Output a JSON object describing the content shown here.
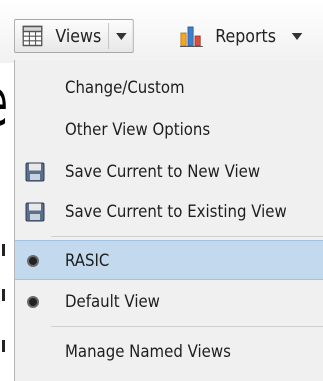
{
  "background": {
    "partial_glyph": "e"
  },
  "toolbar": {
    "views_label": "Views",
    "reports_label": "Reports"
  },
  "menu": {
    "items": [
      {
        "label": "Change/Custom",
        "icon": null
      },
      {
        "label": "Other View Options",
        "icon": null
      },
      {
        "label": "Save Current to New View",
        "icon": "floppy-disk-icon"
      },
      {
        "label": "Save Current to Existing View",
        "icon": "floppy-disk-icon"
      },
      {
        "label": "RASIC",
        "icon": "radio-dot-icon",
        "selected": true
      },
      {
        "label": "Default View",
        "icon": "radio-dot-icon"
      },
      {
        "label": "Manage Named Views",
        "icon": null
      }
    ]
  },
  "colors": {
    "menu_bg": "#f0f0f0",
    "selected_bg": "#c3d9ee",
    "reports_bar_1": "#f5a623",
    "reports_bar_2": "#3c7fd1",
    "reports_bar_3": "#e04b3c"
  }
}
